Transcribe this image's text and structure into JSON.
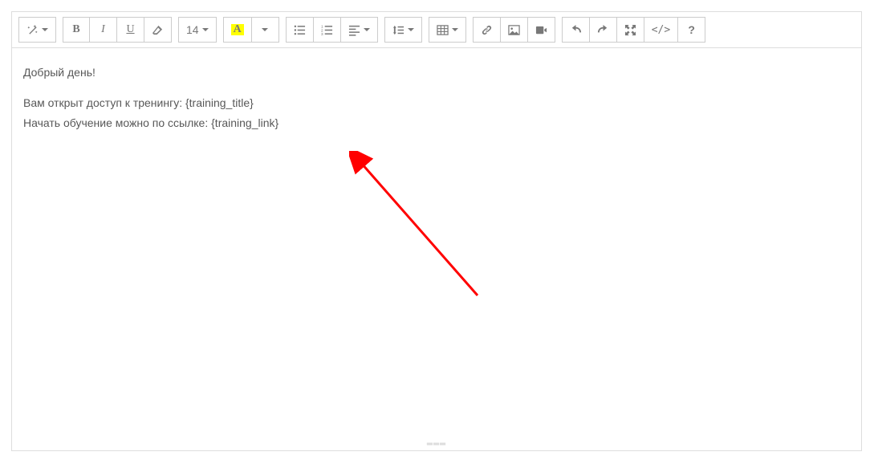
{
  "toolbar": {
    "font_size": "14",
    "font_color_letter": "A"
  },
  "content": {
    "line1": "Добрый день!",
    "line2": "Вам открыт доступ к тренингу: {training_title}",
    "line3": "Начать обучение можно по ссылке: {training_link}"
  }
}
